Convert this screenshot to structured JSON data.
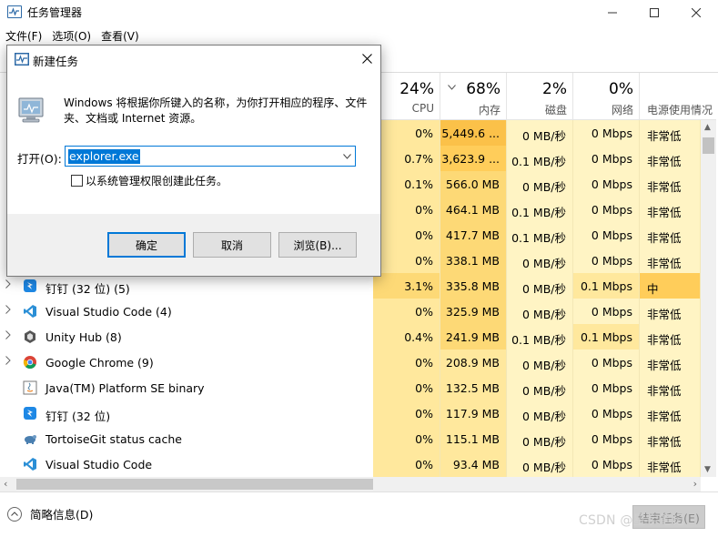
{
  "window": {
    "title": "任务管理器",
    "menu": [
      "文件(F)",
      "选项(O)",
      "查看(V)"
    ]
  },
  "columns": {
    "cpu": {
      "pct": "24%",
      "label": "CPU"
    },
    "mem": {
      "pct": "68%",
      "label": "内存"
    },
    "disk": {
      "pct": "2%",
      "label": "磁盘"
    },
    "net": {
      "pct": "0%",
      "label": "网络"
    },
    "power": {
      "label": "电源使用情况"
    }
  },
  "rows": [
    {
      "name": "",
      "cpu": "0%",
      "mem": "5,449.6 ...",
      "disk": "0 MB/秒",
      "net": "0 Mbps",
      "power": "非常低"
    },
    {
      "name": "",
      "cpu": "0.7%",
      "mem": "3,623.9 ...",
      "disk": "0.1 MB/秒",
      "net": "0 Mbps",
      "power": "非常低"
    },
    {
      "name": "",
      "cpu": "0.1%",
      "mem": "566.0 MB",
      "disk": "0 MB/秒",
      "net": "0 Mbps",
      "power": "非常低"
    },
    {
      "name": "",
      "cpu": "0%",
      "mem": "464.1 MB",
      "disk": "0.1 MB/秒",
      "net": "0 Mbps",
      "power": "非常低"
    },
    {
      "name": "",
      "cpu": "0%",
      "mem": "417.7 MB",
      "disk": "0.1 MB/秒",
      "net": "0 Mbps",
      "power": "非常低"
    },
    {
      "name": "",
      "cpu": "0%",
      "mem": "338.1 MB",
      "disk": "0 MB/秒",
      "net": "0 Mbps",
      "power": "非常低"
    },
    {
      "name": "钉钉 (32 位) (5)",
      "cpu": "3.1%",
      "mem": "335.8 MB",
      "disk": "0 MB/秒",
      "net": "0.1 Mbps",
      "power": "中"
    },
    {
      "name": "Visual Studio Code (4)",
      "cpu": "0%",
      "mem": "325.9 MB",
      "disk": "0 MB/秒",
      "net": "0 Mbps",
      "power": "非常低"
    },
    {
      "name": "Unity Hub (8)",
      "cpu": "0.4%",
      "mem": "241.9 MB",
      "disk": "0.1 MB/秒",
      "net": "0.1 Mbps",
      "power": "非常低"
    },
    {
      "name": "Google Chrome (9)",
      "cpu": "0%",
      "mem": "208.9 MB",
      "disk": "0 MB/秒",
      "net": "0 Mbps",
      "power": "非常低"
    },
    {
      "name": "Java(TM) Platform SE binary",
      "cpu": "0%",
      "mem": "132.5 MB",
      "disk": "0 MB/秒",
      "net": "0 Mbps",
      "power": "非常低"
    },
    {
      "name": "钉钉 (32 位)",
      "cpu": "0%",
      "mem": "117.9 MB",
      "disk": "0 MB/秒",
      "net": "0 Mbps",
      "power": "非常低"
    },
    {
      "name": "TortoiseGit status cache",
      "cpu": "0%",
      "mem": "115.1 MB",
      "disk": "0 MB/秒",
      "net": "0 Mbps",
      "power": "非常低"
    },
    {
      "name": "Visual Studio Code",
      "cpu": "0%",
      "mem": "93.4 MB",
      "disk": "0 MB/秒",
      "net": "0 Mbps",
      "power": "非常低"
    }
  ],
  "footer": {
    "less_details": "简略信息(D)",
    "end_task": "结束任务(E)",
    "watermark": "CSDN @星宇笔记"
  },
  "dialog": {
    "title": "新建任务",
    "description": "Windows 将根据你所键入的名称，为你打开相应的程序、文件夹、文档或 Internet 资源。",
    "open_label": "打开(O):",
    "open_value": "explorer.exe",
    "admin_label": "以系统管理权限创建此任务。",
    "ok": "确定",
    "cancel": "取消",
    "browse": "浏览(B)..."
  },
  "colors": {
    "accent": "#0078d7",
    "heat_low": "#fff4c4",
    "heat_mid": "#ffe89d",
    "heat_high": "#fbc149"
  }
}
